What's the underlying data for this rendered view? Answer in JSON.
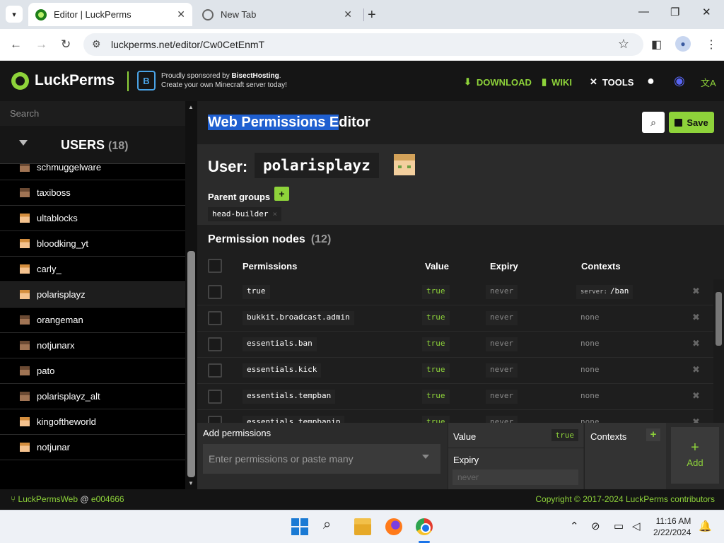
{
  "browser": {
    "tabs": [
      {
        "title": "Editor | LuckPerms",
        "active": true
      },
      {
        "title": "New Tab",
        "active": false
      }
    ],
    "url": "luckperms.net/editor/Cw0CetEnmT",
    "new_tab_symbol": "+",
    "close_symbol": "✕"
  },
  "header": {
    "brand": "LuckPerms",
    "sponsor_line1_prefix": "Proudly sponsored by ",
    "sponsor_name": "BisectHosting",
    "sponsor_line2": "Create your own Minecraft server today!",
    "nav": [
      {
        "label": "DOWNLOAD",
        "icon": "download-icon"
      },
      {
        "label": "WIKI",
        "icon": "book-icon"
      },
      {
        "label": "TOOLS",
        "icon": "tools-icon"
      }
    ],
    "accent": "#8ed33a"
  },
  "sidebar": {
    "search_placeholder": "Search",
    "section_title": "USERS",
    "section_count": "(18)",
    "users": [
      {
        "name": "schmuggelware",
        "skin": "dark"
      },
      {
        "name": "taxiboss",
        "skin": "dark"
      },
      {
        "name": "ultablocks",
        "skin": "light"
      },
      {
        "name": "bloodking_yt",
        "skin": "light"
      },
      {
        "name": "carly_",
        "skin": "light"
      },
      {
        "name": "polarisplayz",
        "skin": "light",
        "selected": true
      },
      {
        "name": "orangeman",
        "skin": "dark"
      },
      {
        "name": "notjunarx",
        "skin": "dark"
      },
      {
        "name": "pato",
        "skin": "dark"
      },
      {
        "name": "polarisplayz_alt",
        "skin": "dark"
      },
      {
        "name": "kingoftheworld",
        "skin": "light"
      },
      {
        "name": "notjunar",
        "skin": "light"
      }
    ]
  },
  "editor": {
    "title_highlighted": "Web Permissions E",
    "title_rest": "ditor",
    "save_label": "Save",
    "user_label": "User:",
    "username": "polarisplayz",
    "parent_groups_label": "Parent groups",
    "parent_groups": [
      "head-builder"
    ],
    "permission_nodes_label": "Permission nodes",
    "permission_nodes_count": "(12)",
    "columns": {
      "permissions": "Permissions",
      "value": "Value",
      "expiry": "Expiry",
      "contexts": "Contexts"
    },
    "rows": [
      {
        "permission": "true",
        "value": "true",
        "expiry": "never",
        "context_key": "server:",
        "context_value": "/ban"
      },
      {
        "permission": "bukkit.broadcast.admin",
        "value": "true",
        "expiry": "never",
        "context": "none"
      },
      {
        "permission": "essentials.ban",
        "value": "true",
        "expiry": "never",
        "context": "none"
      },
      {
        "permission": "essentials.kick",
        "value": "true",
        "expiry": "never",
        "context": "none"
      },
      {
        "permission": "essentials.tempban",
        "value": "true",
        "expiry": "never",
        "context": "none"
      },
      {
        "permission": "essentials.tempbanip",
        "value": "true",
        "expiry": "never",
        "context": "none"
      }
    ]
  },
  "add_panel": {
    "label": "Add permissions",
    "input_placeholder": "Enter permissions or paste many",
    "value_label": "Value",
    "value": "true",
    "expiry_label": "Expiry",
    "expiry_placeholder": "never",
    "contexts_label": "Contexts",
    "add_label": "Add"
  },
  "footer": {
    "app": "LuckPermsWeb",
    "at": " @ ",
    "commit": "e004666",
    "copyright": "Copyright © 2017-2024 LuckPerms contributors"
  },
  "taskbar": {
    "time": "11:16 AM",
    "date": "2/22/2024"
  }
}
